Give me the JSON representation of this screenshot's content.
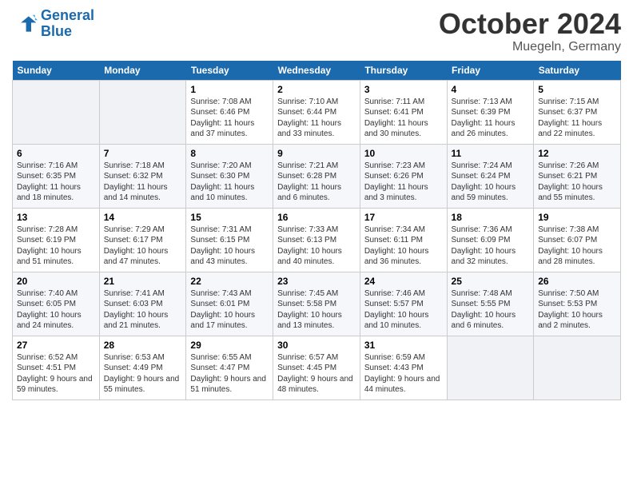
{
  "header": {
    "logo_line1": "General",
    "logo_line2": "Blue",
    "month": "October 2024",
    "location": "Muegeln, Germany"
  },
  "weekdays": [
    "Sunday",
    "Monday",
    "Tuesday",
    "Wednesday",
    "Thursday",
    "Friday",
    "Saturday"
  ],
  "weeks": [
    [
      {
        "day": "",
        "detail": ""
      },
      {
        "day": "",
        "detail": ""
      },
      {
        "day": "1",
        "detail": "Sunrise: 7:08 AM\nSunset: 6:46 PM\nDaylight: 11 hours\nand 37 minutes."
      },
      {
        "day": "2",
        "detail": "Sunrise: 7:10 AM\nSunset: 6:44 PM\nDaylight: 11 hours\nand 33 minutes."
      },
      {
        "day": "3",
        "detail": "Sunrise: 7:11 AM\nSunset: 6:41 PM\nDaylight: 11 hours\nand 30 minutes."
      },
      {
        "day": "4",
        "detail": "Sunrise: 7:13 AM\nSunset: 6:39 PM\nDaylight: 11 hours\nand 26 minutes."
      },
      {
        "day": "5",
        "detail": "Sunrise: 7:15 AM\nSunset: 6:37 PM\nDaylight: 11 hours\nand 22 minutes."
      }
    ],
    [
      {
        "day": "6",
        "detail": "Sunrise: 7:16 AM\nSunset: 6:35 PM\nDaylight: 11 hours\nand 18 minutes."
      },
      {
        "day": "7",
        "detail": "Sunrise: 7:18 AM\nSunset: 6:32 PM\nDaylight: 11 hours\nand 14 minutes."
      },
      {
        "day": "8",
        "detail": "Sunrise: 7:20 AM\nSunset: 6:30 PM\nDaylight: 11 hours\nand 10 minutes."
      },
      {
        "day": "9",
        "detail": "Sunrise: 7:21 AM\nSunset: 6:28 PM\nDaylight: 11 hours\nand 6 minutes."
      },
      {
        "day": "10",
        "detail": "Sunrise: 7:23 AM\nSunset: 6:26 PM\nDaylight: 11 hours\nand 3 minutes."
      },
      {
        "day": "11",
        "detail": "Sunrise: 7:24 AM\nSunset: 6:24 PM\nDaylight: 10 hours\nand 59 minutes."
      },
      {
        "day": "12",
        "detail": "Sunrise: 7:26 AM\nSunset: 6:21 PM\nDaylight: 10 hours\nand 55 minutes."
      }
    ],
    [
      {
        "day": "13",
        "detail": "Sunrise: 7:28 AM\nSunset: 6:19 PM\nDaylight: 10 hours\nand 51 minutes."
      },
      {
        "day": "14",
        "detail": "Sunrise: 7:29 AM\nSunset: 6:17 PM\nDaylight: 10 hours\nand 47 minutes."
      },
      {
        "day": "15",
        "detail": "Sunrise: 7:31 AM\nSunset: 6:15 PM\nDaylight: 10 hours\nand 43 minutes."
      },
      {
        "day": "16",
        "detail": "Sunrise: 7:33 AM\nSunset: 6:13 PM\nDaylight: 10 hours\nand 40 minutes."
      },
      {
        "day": "17",
        "detail": "Sunrise: 7:34 AM\nSunset: 6:11 PM\nDaylight: 10 hours\nand 36 minutes."
      },
      {
        "day": "18",
        "detail": "Sunrise: 7:36 AM\nSunset: 6:09 PM\nDaylight: 10 hours\nand 32 minutes."
      },
      {
        "day": "19",
        "detail": "Sunrise: 7:38 AM\nSunset: 6:07 PM\nDaylight: 10 hours\nand 28 minutes."
      }
    ],
    [
      {
        "day": "20",
        "detail": "Sunrise: 7:40 AM\nSunset: 6:05 PM\nDaylight: 10 hours\nand 24 minutes."
      },
      {
        "day": "21",
        "detail": "Sunrise: 7:41 AM\nSunset: 6:03 PM\nDaylight: 10 hours\nand 21 minutes."
      },
      {
        "day": "22",
        "detail": "Sunrise: 7:43 AM\nSunset: 6:01 PM\nDaylight: 10 hours\nand 17 minutes."
      },
      {
        "day": "23",
        "detail": "Sunrise: 7:45 AM\nSunset: 5:58 PM\nDaylight: 10 hours\nand 13 minutes."
      },
      {
        "day": "24",
        "detail": "Sunrise: 7:46 AM\nSunset: 5:57 PM\nDaylight: 10 hours\nand 10 minutes."
      },
      {
        "day": "25",
        "detail": "Sunrise: 7:48 AM\nSunset: 5:55 PM\nDaylight: 10 hours\nand 6 minutes."
      },
      {
        "day": "26",
        "detail": "Sunrise: 7:50 AM\nSunset: 5:53 PM\nDaylight: 10 hours\nand 2 minutes."
      }
    ],
    [
      {
        "day": "27",
        "detail": "Sunrise: 6:52 AM\nSunset: 4:51 PM\nDaylight: 9 hours\nand 59 minutes."
      },
      {
        "day": "28",
        "detail": "Sunrise: 6:53 AM\nSunset: 4:49 PM\nDaylight: 9 hours\nand 55 minutes."
      },
      {
        "day": "29",
        "detail": "Sunrise: 6:55 AM\nSunset: 4:47 PM\nDaylight: 9 hours\nand 51 minutes."
      },
      {
        "day": "30",
        "detail": "Sunrise: 6:57 AM\nSunset: 4:45 PM\nDaylight: 9 hours\nand 48 minutes."
      },
      {
        "day": "31",
        "detail": "Sunrise: 6:59 AM\nSunset: 4:43 PM\nDaylight: 9 hours\nand 44 minutes."
      },
      {
        "day": "",
        "detail": ""
      },
      {
        "day": "",
        "detail": ""
      }
    ]
  ]
}
